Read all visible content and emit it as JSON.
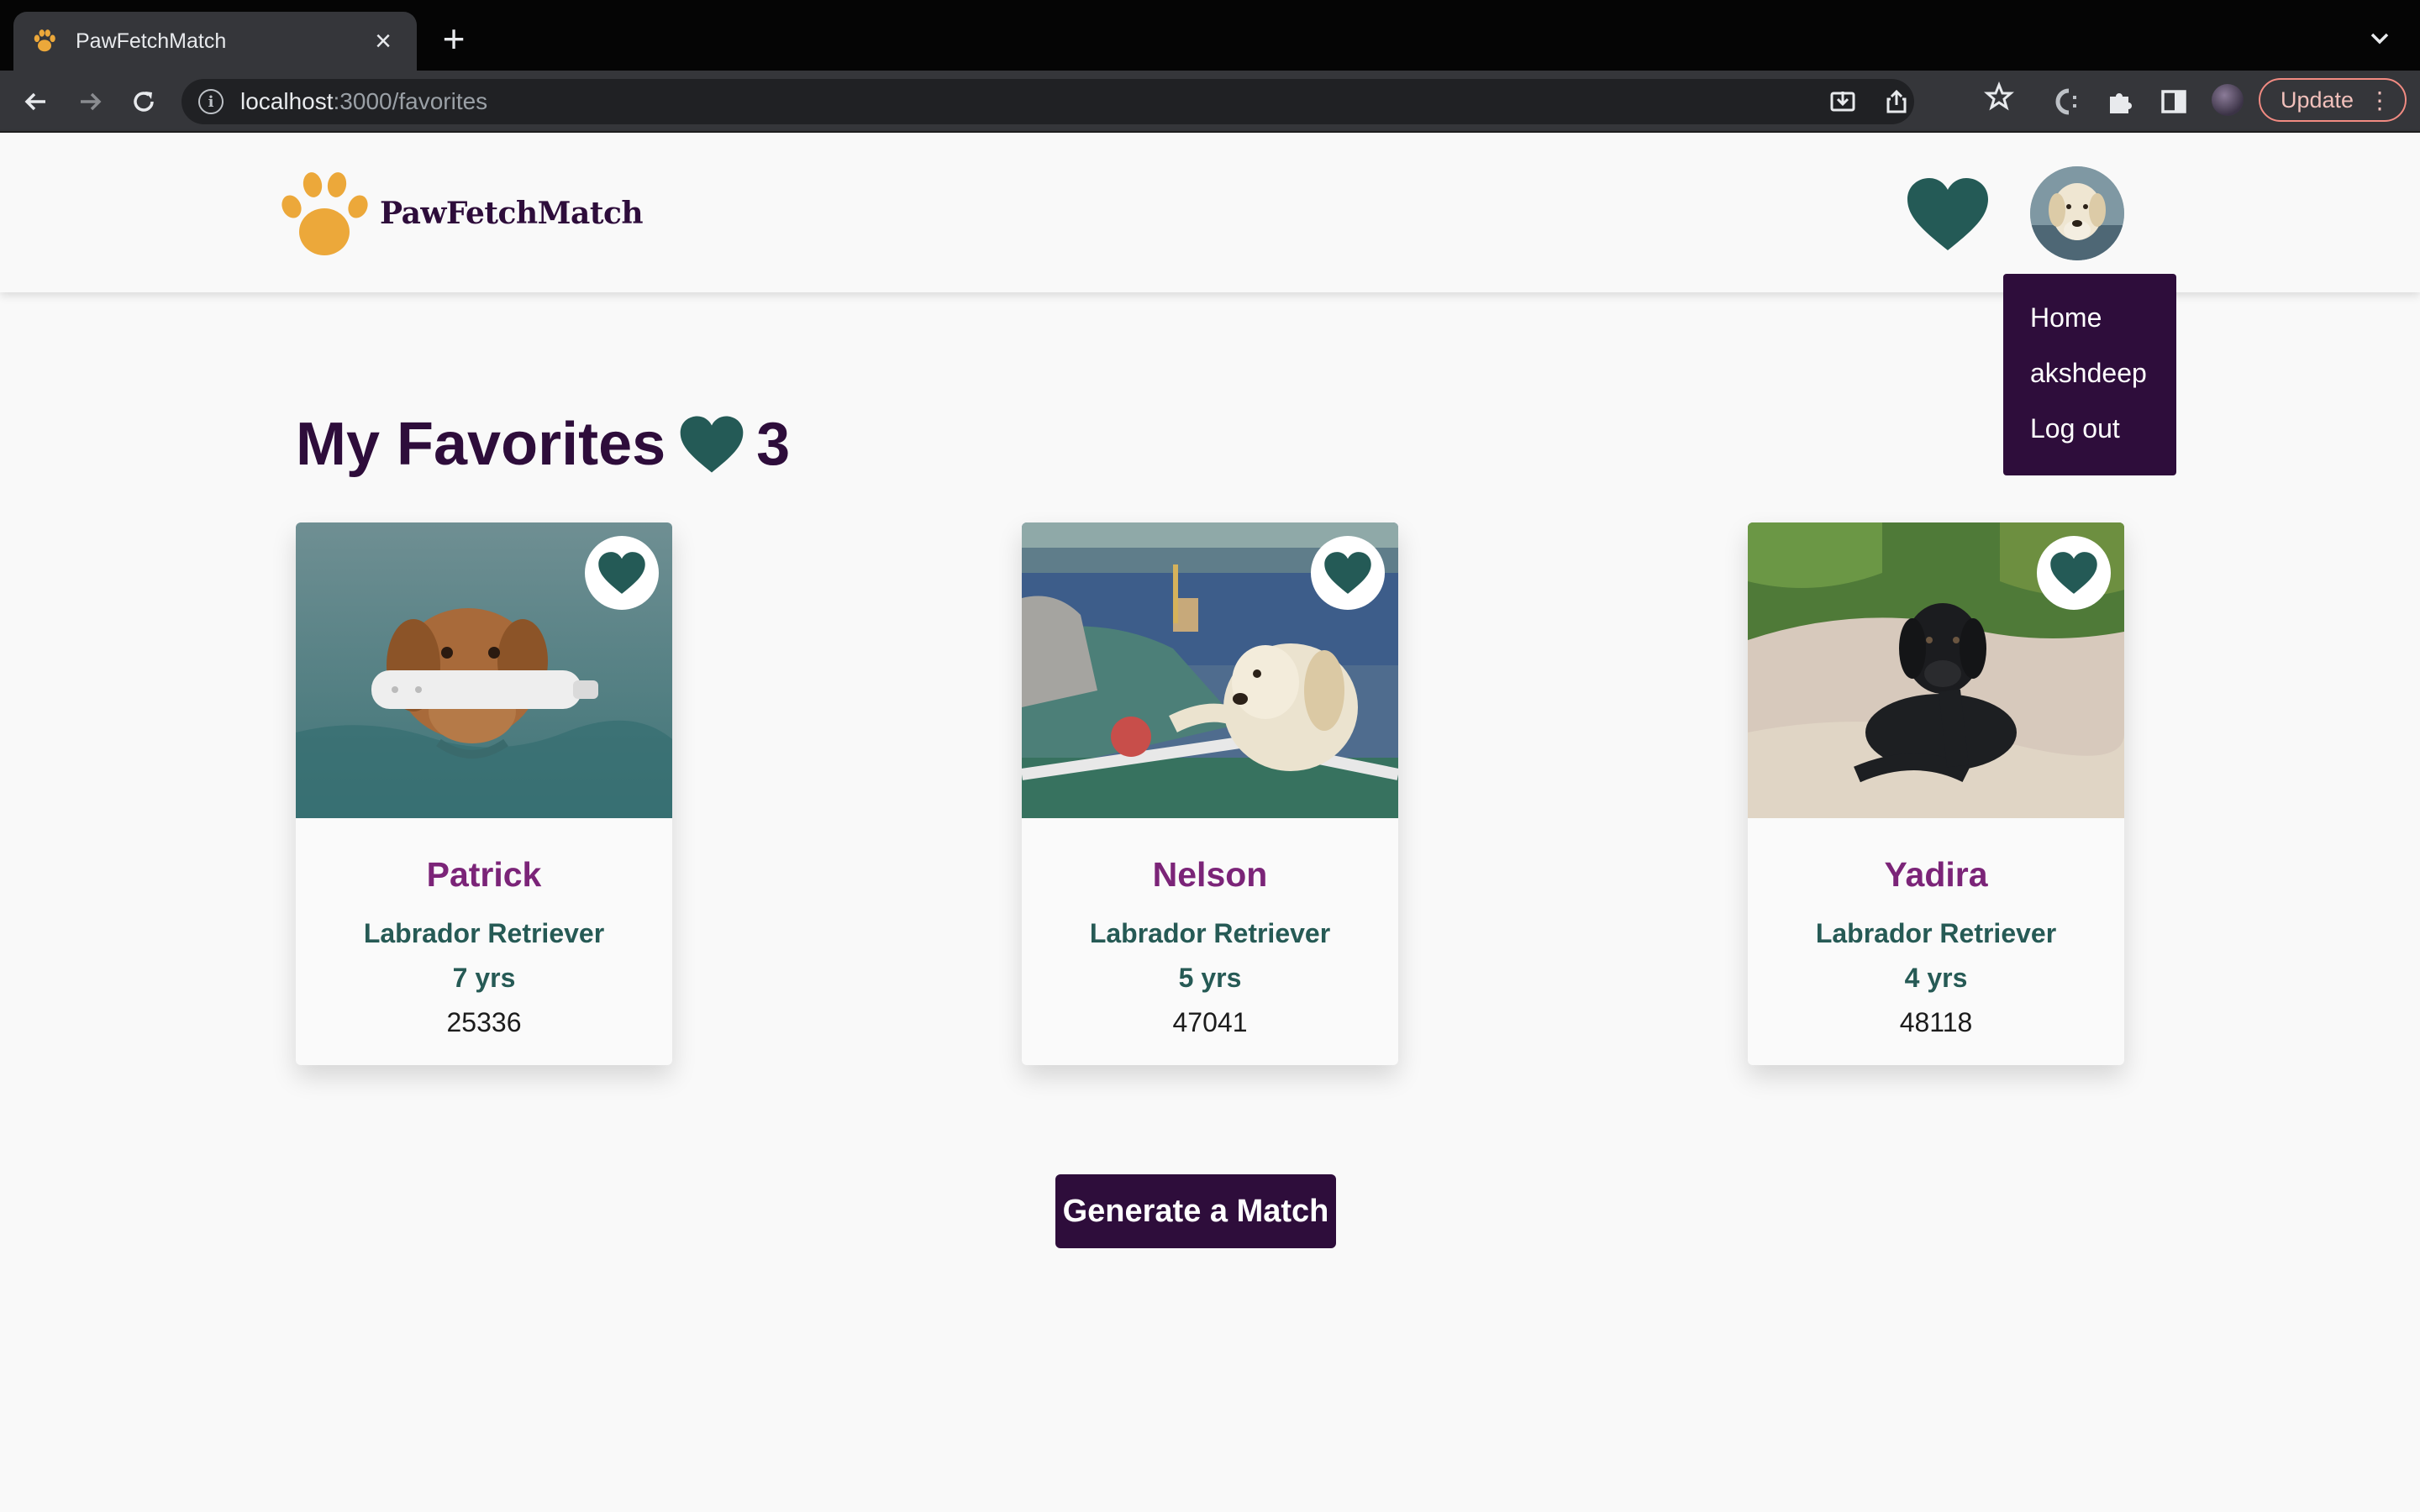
{
  "browser": {
    "tab_title": "PawFetchMatch",
    "url_host": "localhost",
    "url_path": ":3000/favorites",
    "update_label": "Update",
    "icons": [
      "back-icon",
      "forward-icon",
      "reload-icon",
      "info-icon",
      "install-icon",
      "share-icon",
      "star-icon",
      "extension-icon",
      "puzzle-icon",
      "sidepanel-icon",
      "kebab-menu-icon"
    ]
  },
  "header": {
    "logo_text": "PawFetchMatch",
    "favorites_icon": "heart-icon",
    "accent_color": "#245a56",
    "brand_color": "#2e0d3b",
    "paw_color": "#eca83a"
  },
  "menu": {
    "items": [
      "Home",
      "akshdeep",
      "Log out"
    ]
  },
  "main": {
    "title": "My Favorites",
    "count": "3",
    "generate_label": "Generate a Match"
  },
  "dogs": [
    {
      "name": "Patrick",
      "breed": "Labrador Retriever",
      "age": "7 yrs",
      "zip": "25336",
      "photo": "golden retriever swimming with toy"
    },
    {
      "name": "Nelson",
      "breed": "Labrador Retriever",
      "age": "5 yrs",
      "zip": "47041",
      "photo": "yellow labrador on boat with ball"
    },
    {
      "name": "Yadira",
      "breed": "Labrador Retriever",
      "age": "4 yrs",
      "zip": "48118",
      "photo": "black labrador lying in sand"
    }
  ]
}
